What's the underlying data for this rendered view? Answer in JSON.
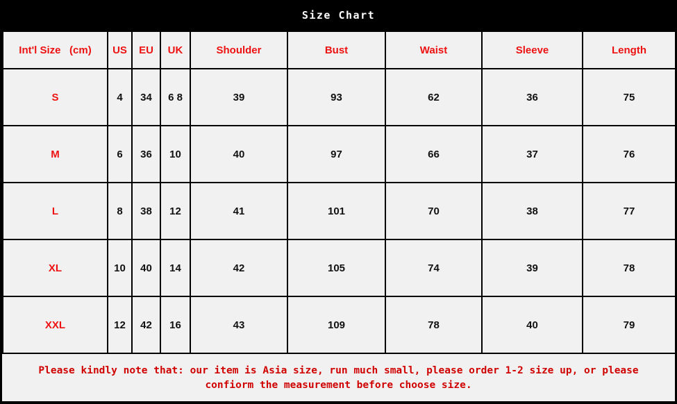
{
  "title": "Size Chart",
  "table": {
    "headers": [
      "Int'l Size   (cm)",
      "US",
      "EU",
      "UK",
      "Shoulder",
      "Bust",
      "Waist",
      "Sleeve",
      "Length"
    ],
    "rows": [
      {
        "size": "S",
        "us": "4",
        "eu": "34",
        "uk": "6 8",
        "shoulder": "39",
        "bust": "93",
        "waist": "62",
        "sleeve": "36",
        "length": "75"
      },
      {
        "size": "M",
        "us": "6",
        "eu": "36",
        "uk": "10",
        "shoulder": "40",
        "bust": "97",
        "waist": "66",
        "sleeve": "37",
        "length": "76"
      },
      {
        "size": "L",
        "us": "8",
        "eu": "38",
        "uk": "12",
        "shoulder": "41",
        "bust": "101",
        "waist": "70",
        "sleeve": "38",
        "length": "77"
      },
      {
        "size": "XL",
        "us": "10",
        "eu": "40",
        "uk": "14",
        "shoulder": "42",
        "bust": "105",
        "waist": "74",
        "sleeve": "39",
        "length": "78"
      },
      {
        "size": "XXL",
        "us": "12",
        "eu": "42",
        "uk": "16",
        "shoulder": "43",
        "bust": "109",
        "waist": "78",
        "sleeve": "40",
        "length": "79"
      }
    ]
  },
  "note": {
    "line1": "Please  kindly note that: our item is Asia size, run much small, please order 1-2 size up, or please",
    "line2": "confiorm the measurement before choose size."
  },
  "colors": {
    "accent_red": "#ee1111",
    "note_red": "#d00000",
    "cell_bg": "#f1f1f1",
    "border": "#000000",
    "title_bg": "#000000",
    "title_fg": "#ffffff"
  },
  "chart_data": {
    "type": "table",
    "title": "Size Chart",
    "columns": [
      "Int'l Size   (cm)",
      "US",
      "EU",
      "UK",
      "Shoulder",
      "Bust",
      "Waist",
      "Sleeve",
      "Length"
    ],
    "rows": [
      [
        "S",
        "4",
        "34",
        "6 8",
        "39",
        "93",
        "62",
        "36",
        "75"
      ],
      [
        "M",
        "6",
        "36",
        "10",
        "40",
        "97",
        "66",
        "37",
        "76"
      ],
      [
        "L",
        "8",
        "38",
        "12",
        "41",
        "101",
        "70",
        "38",
        "77"
      ],
      [
        "XL",
        "10",
        "40",
        "14",
        "42",
        "105",
        "74",
        "39",
        "78"
      ],
      [
        "XXL",
        "12",
        "42",
        "16",
        "43",
        "109",
        "78",
        "40",
        "79"
      ]
    ],
    "units": "cm"
  }
}
